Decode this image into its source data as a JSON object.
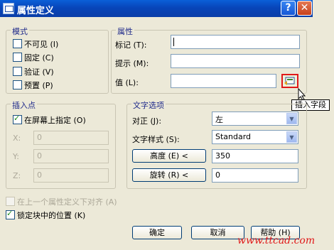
{
  "title": "属性定义",
  "titlebar": {
    "help_label": "?",
    "close_label": "✕",
    "app_icon": "autocad-icon"
  },
  "mode": {
    "title": "模式",
    "items": [
      {
        "label": "不可见 (I)",
        "checked": false
      },
      {
        "label": "固定 (C)",
        "checked": false
      },
      {
        "label": "验证 (V)",
        "checked": false
      },
      {
        "label": "预置 (P)",
        "checked": false
      }
    ]
  },
  "attribute": {
    "title": "属性",
    "tag_label": "标记 (T):",
    "tag_value": "",
    "prompt_label": "提示 (M):",
    "prompt_value": "",
    "value_label": "值 (L):",
    "value_value": "",
    "insert_field_icon": "insert-field-icon"
  },
  "tooltip": "插入字段",
  "insertion": {
    "title": "插入点",
    "on_screen_label": "在屏幕上指定 (O)",
    "on_screen_checked": true,
    "x_label": "X:",
    "x_value": "0",
    "y_label": "Y:",
    "y_value": "0",
    "z_label": "Z:",
    "z_value": "0"
  },
  "text_options": {
    "title": "文字选项",
    "justify_label": "对正 (J):",
    "justify_value": "左",
    "style_label": "文字样式 (S):",
    "style_value": "Standard",
    "height_button": "高度 (E) <",
    "height_value": "350",
    "rotation_button": "旋转 (R) <",
    "rotation_value": "0"
  },
  "align_below": {
    "label": "在上一个属性定义下对齐 (A)",
    "checked": false,
    "enabled": false
  },
  "lock_position": {
    "label": "锁定块中的位置 (K)",
    "checked": true
  },
  "buttons": {
    "ok": "确定",
    "cancel": "取消",
    "help": "帮助 (H)"
  },
  "watermark": "www.ttcad.com",
  "colors": {
    "title_bar": "#0845b9",
    "dialog_bg": "#ece9d8",
    "highlight": "#e0191a"
  }
}
